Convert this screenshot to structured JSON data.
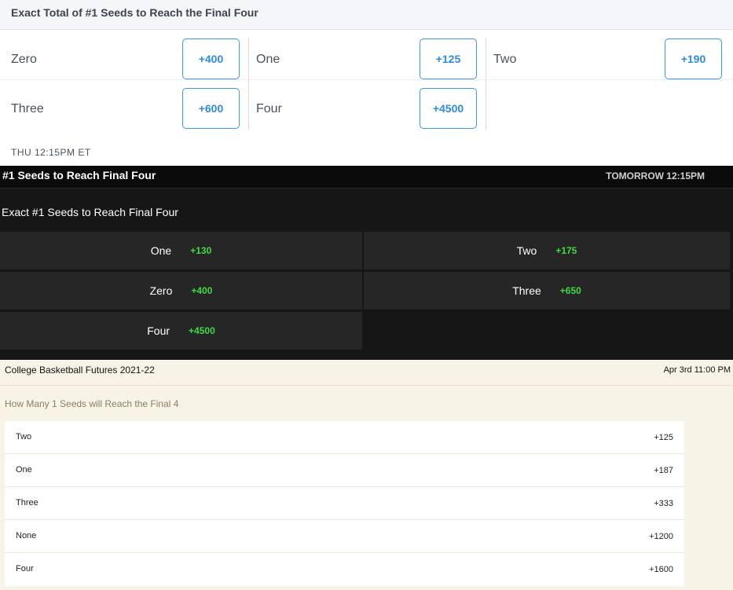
{
  "section1": {
    "title": "Exact Total of #1 Seeds to Reach the Final Four",
    "options": [
      {
        "label": "Zero",
        "odds": "+400"
      },
      {
        "label": "One",
        "odds": "+125"
      },
      {
        "label": "Two",
        "odds": "+190"
      },
      {
        "label": "Three",
        "odds": "+600"
      },
      {
        "label": "Four",
        "odds": "+4500"
      }
    ],
    "time": "THU 12:15PM ET",
    "colors": {
      "accent": "#2d8be3",
      "header_bg": "#f4f6fa"
    }
  },
  "section2": {
    "title": "#1 Seeds to Reach Final Four",
    "time": "TOMORROW 12:15PM",
    "subtitle": "Exact #1 Seeds to Reach Final Four",
    "options": [
      {
        "label": "One",
        "odds": "+130"
      },
      {
        "label": "Two",
        "odds": "+175"
      },
      {
        "label": "Zero",
        "odds": "+400"
      },
      {
        "label": "Three",
        "odds": "+650"
      },
      {
        "label": "Four",
        "odds": "+4500"
      }
    ],
    "colors": {
      "accent": "#3ddc43",
      "bg": "#161616",
      "tile": "#262626"
    }
  },
  "section3": {
    "title": "College Basketball Futures 2021-22",
    "time": "Apr 3rd 11:00 PM",
    "question": "How Many 1 Seeds will Reach the Final 4",
    "rows": [
      {
        "label": "Two",
        "odds": "+125"
      },
      {
        "label": "One",
        "odds": "+187"
      },
      {
        "label": "Three",
        "odds": "+333"
      },
      {
        "label": "None",
        "odds": "+1200"
      },
      {
        "label": "Four",
        "odds": "+1600"
      }
    ],
    "colors": {
      "bg": "#f7f3e6"
    }
  }
}
